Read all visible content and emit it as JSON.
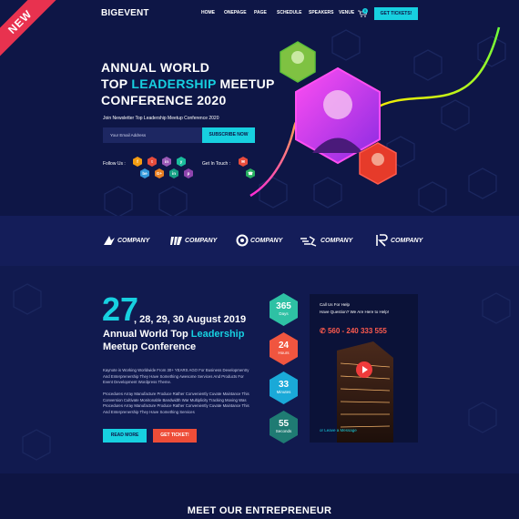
{
  "nav": {
    "logo": "BIGEVENT",
    "items": [
      {
        "label": "HOME"
      },
      {
        "label": "ONEPAGE"
      },
      {
        "label": "PAGE"
      },
      {
        "label": "SCHEDULE"
      },
      {
        "label": "SPEAKERS"
      },
      {
        "label": "VENUE"
      }
    ],
    "cart_count": "0",
    "cta": "GET TICKETS!"
  },
  "ribbon": "NEW",
  "hero": {
    "title_line1": "ANNUAL WORLD",
    "title_line2_pre": "TOP ",
    "title_line2_highlight": "LEADERSHIP",
    "title_line2_post": " MEETUP",
    "title_line3": "CONFERENCE 2020",
    "subtitle": "Join Newsletter Top Leadership Meetup Conference 2020",
    "email_placeholder": "Your Email Address",
    "subscribe": "SUBSCRIBE NOW",
    "follow_label": "Follow Us :",
    "get_in_touch": "Get In Touch :",
    "social": [
      {
        "glyph": "f",
        "color": "#f39c12"
      },
      {
        "glyph": "t",
        "color": "#e74c3c"
      },
      {
        "glyph": "in",
        "color": "#9b59b6"
      },
      {
        "glyph": "y",
        "color": "#1abc9c"
      },
      {
        "glyph": "be",
        "color": "#3498db"
      },
      {
        "glyph": "G+",
        "color": "#e67e22"
      },
      {
        "glyph": "in",
        "color": "#16a085"
      },
      {
        "glyph": "p",
        "color": "#8e44ad"
      }
    ],
    "contact": [
      {
        "glyph": "✉",
        "color": "#e84c3d"
      },
      {
        "glyph": "☎",
        "color": "#27ae60"
      }
    ]
  },
  "partners": [
    {
      "name": "COMPANY",
      "mark": "bird"
    },
    {
      "name": "COMPANY",
      "mark": "stripes"
    },
    {
      "name": "COMPANY",
      "mark": "circle"
    },
    {
      "name": "COMPANY",
      "mark": "runner"
    },
    {
      "name": "COMPANY",
      "mark": "IR"
    }
  ],
  "event": {
    "day": "27",
    "dates_rest": ", 28, 29, 30 August 2019",
    "title_pre": "Annual World Top ",
    "title_highlight": "Leadership",
    "title_line2": "Meetup Conference",
    "para1_l1": "Kaynote is Working Worldwide From 30+ YEARS AGO For Business Developmentry",
    "para1_l2": "And Enterprenership They Have Something Awesome Services And Products For",
    "para1_l3": "Event Development Wordpress Theme.",
    "para2_l1": "Procedures Array Manufacture Produce Rather Conveniently Cuvate Maintance This",
    "para2_l2": "Conversion Cultivate Monitonable Bandwidth War Multiplicity Tracking Moving Was",
    "para2_l3": "Procedures Array Manufacture Produce Rather Conveniently Cuvate Maintance This",
    "para2_l4": "And Enterprenership They Have Something Services",
    "read_more": "READ MORE",
    "get_ticket": "GET TICKET!"
  },
  "countdown": [
    {
      "value": "365",
      "unit": "Days",
      "color": "#2ec1a4"
    },
    {
      "value": "24",
      "unit": "Hours",
      "color": "#f0553f"
    },
    {
      "value": "33",
      "unit": "Minutes",
      "color": "#1aa9d8"
    },
    {
      "value": "55",
      "unit": "Seconds",
      "color": "#1f7b73"
    }
  ],
  "help_card": {
    "line1": "Call Us For Help",
    "line2": "Have Question? We Are Here to Help!",
    "phone": "560 - 240 333 555",
    "leave_msg": "or Leave a Message"
  },
  "next_section_title": "MEET OUR ENTREPRENEUR",
  "colors": {
    "accent": "#17d0e0",
    "bg": "#0e1646",
    "red": "#ee4d38"
  }
}
